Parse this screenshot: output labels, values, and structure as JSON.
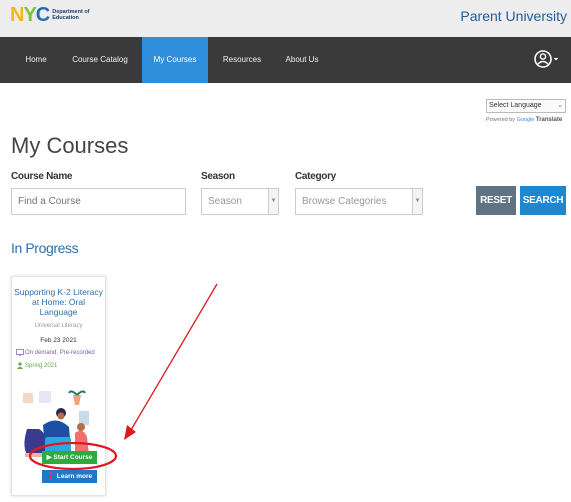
{
  "header": {
    "logo_letters": [
      "N",
      "Y",
      "C"
    ],
    "logo_line1": "Department of",
    "logo_line2": "Education",
    "brand_title": "Parent University"
  },
  "nav": {
    "items": [
      {
        "label": "Home"
      },
      {
        "label": "Course Catalog"
      },
      {
        "label": "My Courses",
        "active": true
      },
      {
        "label": "Resources"
      },
      {
        "label": "About Us"
      }
    ],
    "user_icon": "user-circle-icon"
  },
  "translate": {
    "select_label": "Select Language",
    "powered_by": "Powered by",
    "google": "Google",
    "translate": "Translate"
  },
  "page": {
    "title": "My Courses"
  },
  "filters": {
    "course_name_label": "Course Name",
    "course_name_placeholder": "Find a Course",
    "season_label": "Season",
    "season_value": "Season",
    "category_label": "Category",
    "category_value": "Browse Categories",
    "reset_label": "RESET",
    "search_label": "SEARCH"
  },
  "in_progress": {
    "heading": "In Progress",
    "courses": [
      {
        "title": "Supporting K-2 Literacy at Home: Oral Language",
        "category": "Universal Literacy",
        "date": "Feb 23 2021",
        "format": "On demand, Pre-recorded",
        "season": "Spring 2021",
        "start_label": "Start Course",
        "learn_label": "Learn more"
      }
    ]
  },
  "colors": {
    "nav_bg": "#3a3a3a",
    "nav_active": "#2f8fdc",
    "brand_blue": "#1f5d9e",
    "link_blue": "#2a6fb0",
    "start_green": "#2eab3f",
    "learn_blue": "#2277c6",
    "annotation_red": "#e0191f"
  }
}
